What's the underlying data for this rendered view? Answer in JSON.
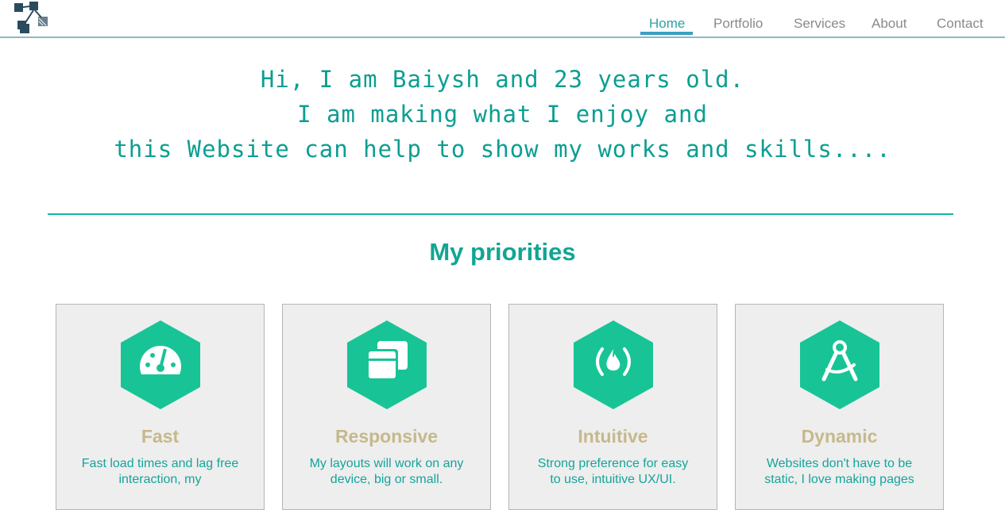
{
  "nav": {
    "logo": "grid-logo-icon",
    "items": [
      {
        "label": "Home",
        "active": true
      },
      {
        "label": "Portfolio",
        "active": false
      },
      {
        "label": "Services",
        "active": false
      },
      {
        "label": "About",
        "active": false
      },
      {
        "label": "Contact",
        "active": false
      }
    ]
  },
  "hero": {
    "lines": [
      "Hi, I am Baiysh and 23 years old.",
      "I am making what I enjoy and",
      "this Website can help to show my works and skills...."
    ]
  },
  "priorities": {
    "title": "My priorities",
    "cards": [
      {
        "icon": "speedometer-icon",
        "title": "Fast",
        "description": "Fast load times and lag free interaction, my"
      },
      {
        "icon": "window-stack-icon",
        "title": "Responsive",
        "description": "My layouts will work on any device, big or small."
      },
      {
        "icon": "fire-code-icon",
        "title": "Intuitive",
        "description": "Strong preference for easy to use, intuitive UX/UI."
      },
      {
        "icon": "compass-icon",
        "title": "Dynamic",
        "description": "Websites don't have to be static, I love making pages"
      }
    ]
  },
  "colors": {
    "accent": "#12a593",
    "hex": "#18c496",
    "card_title": "#c5b98b",
    "nav_active": "#2aa4a0",
    "underline": "#3a9fc0"
  }
}
